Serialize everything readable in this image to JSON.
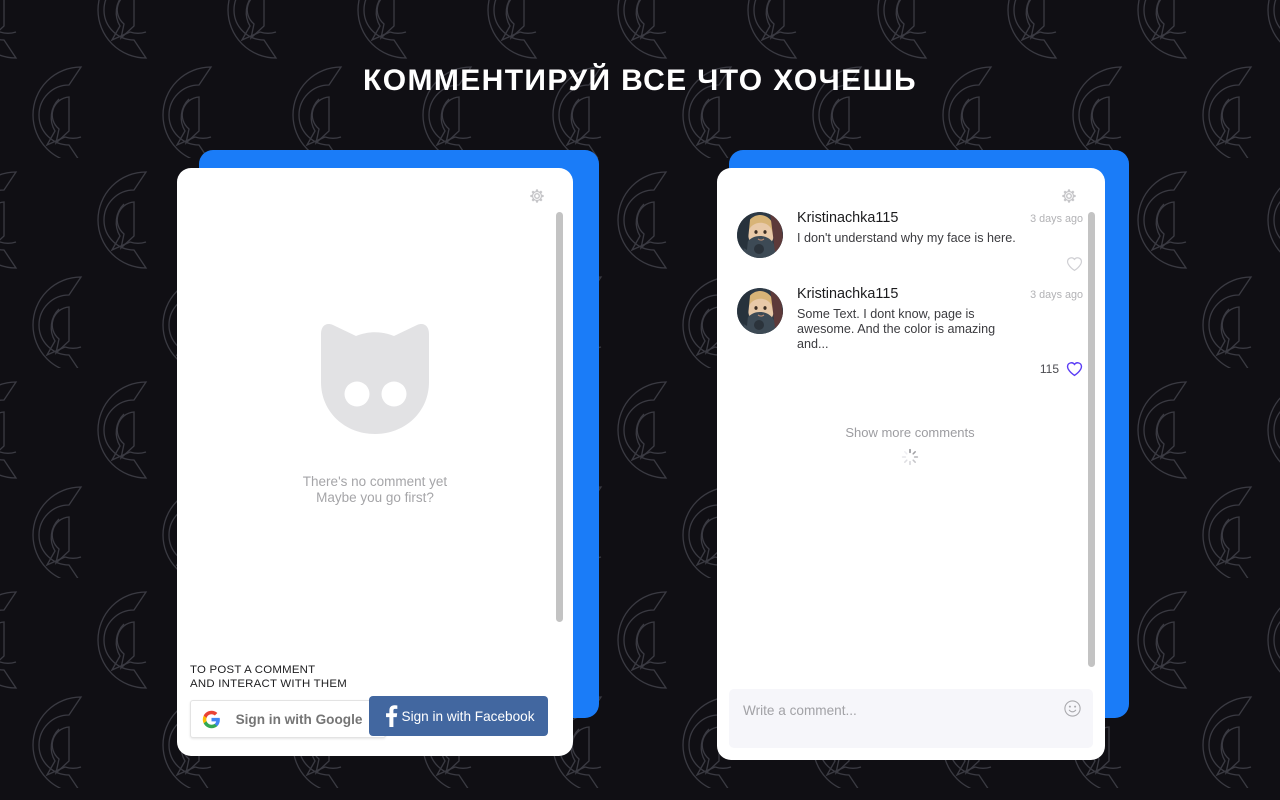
{
  "page": {
    "headline": "КОММЕНТИРУЙ ВСЕ ЧТО ХОЧЕШЬ",
    "background_color": "#100f14",
    "accent_blue": "#1a7cf8",
    "pattern_icon": "c-speech-bubble-logo-pattern"
  },
  "left_panel": {
    "settings_icon": "gear-icon",
    "empty_state": {
      "illustration": "cat-face-icon",
      "line1": "There's no comment yet",
      "line2": "Maybe you go first?"
    },
    "auth": {
      "caption_line1": "TO POST A  COMMENT",
      "caption_line2": "AND INTERACT WITH THEM",
      "google_button": {
        "label": "Sign in with Google",
        "icon": "google-g-icon",
        "text_color": "#757575",
        "background": "#ffffff"
      },
      "facebook_button": {
        "label": "Sign in with Facebook",
        "icon": "facebook-f-icon",
        "text_color": "#ffffff",
        "background": "#4267a0"
      }
    }
  },
  "right_panel": {
    "settings_icon": "gear-icon",
    "comments": [
      {
        "author": "Kristinachka115",
        "timestamp": "3 days ago",
        "text": "I don't understand why my face is here.",
        "avatar": "user-avatar-photo",
        "like_count": "",
        "liked": false,
        "heart_color": "#d0d0d4"
      },
      {
        "author": "Kristinachka115",
        "timestamp": "3 days ago",
        "text": "Some Text. I dont know, page is awesome. And the color is amazing and...",
        "avatar": "user-avatar-photo",
        "like_count": "115",
        "liked": true,
        "heart_color": "#5b3df5"
      }
    ],
    "show_more_label": "Show more comments",
    "loading_indicator": "spinner-icon",
    "composer": {
      "placeholder": "Write a comment...",
      "emoji_icon": "smiley-face-icon"
    }
  }
}
